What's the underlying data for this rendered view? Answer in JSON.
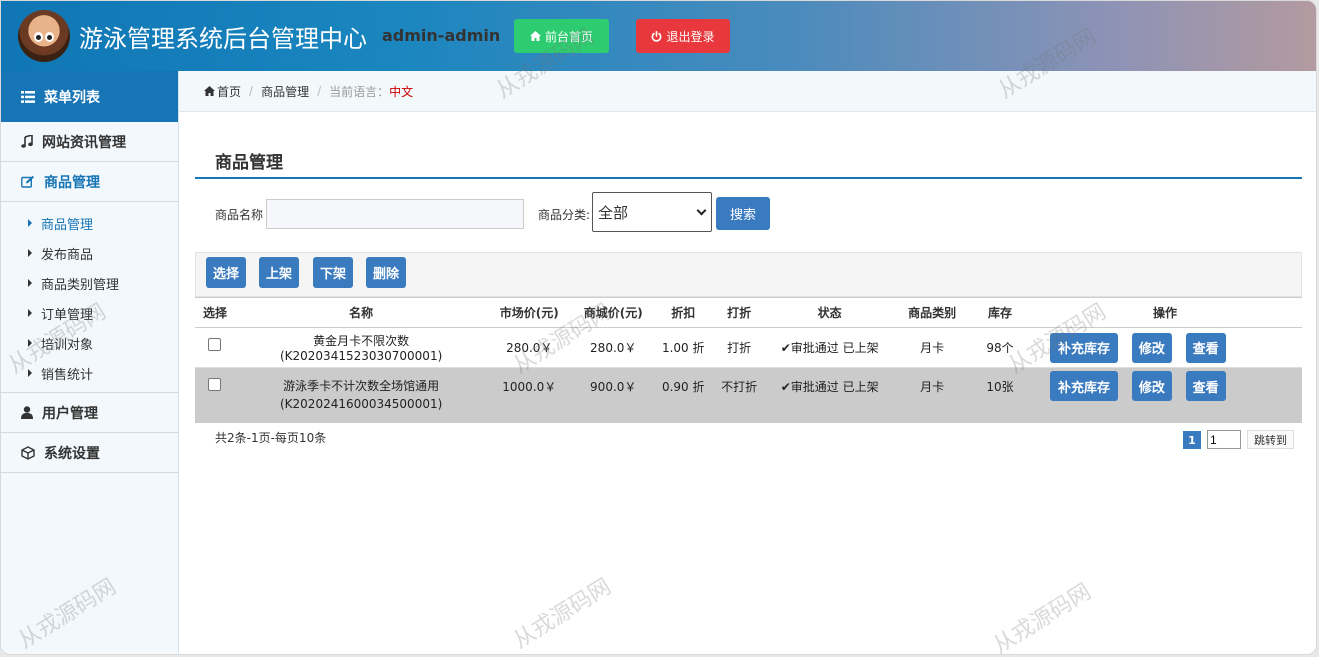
{
  "header": {
    "title": "游泳管理系统后台管理中心",
    "user": "admin-admin",
    "home_button": "前台首页",
    "logout_button": "退出登录"
  },
  "sidebar": {
    "menu_title": "菜单列表",
    "groups": [
      {
        "label": "网站资讯管理",
        "icon": "music-icon"
      },
      {
        "label": "商品管理",
        "icon": "edit-icon"
      },
      {
        "label": "用户管理",
        "icon": "user-icon"
      },
      {
        "label": "系统设置",
        "icon": "cube-icon"
      }
    ],
    "sub_items": [
      "商品管理",
      "发布商品",
      "商品类别管理",
      "订单管理",
      "培训对象",
      "销售统计"
    ]
  },
  "breadcrumb": {
    "home": "首页",
    "current": "商品管理",
    "lang_label": "当前语言：",
    "lang_value": "中文"
  },
  "page": {
    "title": "商品管理"
  },
  "search": {
    "name_label": "商品名称",
    "name_value": "",
    "category_label": "商品分类:",
    "category_value": "全部",
    "search_button": "搜索"
  },
  "toolbar": {
    "select": "选择",
    "on_shelf": "上架",
    "off_shelf": "下架",
    "delete": "删除"
  },
  "table": {
    "columns": [
      "选择",
      "名称",
      "市场价(元)",
      "商城价(元)",
      "折扣",
      "打折",
      "状态",
      "商品类别",
      "库存",
      "操作"
    ],
    "rows": [
      {
        "name": "黄金月卡不限次数(K2020341523030700001)",
        "market_price": "280.0￥",
        "mall_price": "280.0￥",
        "discount": "1.00 折",
        "is_discount": "打折",
        "status": "审批通过 已上架",
        "category": "月卡",
        "stock": "98个"
      },
      {
        "name": "游泳季卡不计次数全场馆通用(K2020241600034500001)",
        "market_price": "1000.0￥",
        "mall_price": "900.0￥",
        "discount": "0.90 折",
        "is_discount": "不打折",
        "status": "审批通过 已上架",
        "category": "月卡",
        "stock": "10张"
      }
    ],
    "action_restock": "补充库存",
    "action_edit": "修改",
    "action_view": "查看"
  },
  "pager": {
    "info": "共2条-1页-每页10条",
    "current_page": "1",
    "jump_input": "1",
    "jump_button": "跳转到"
  },
  "watermark": "从戎源码网",
  "colors": {
    "primary": "#1875b5",
    "button": "#3a7abf",
    "home_green": "#2ecc71",
    "logout_red": "#e8383d"
  }
}
